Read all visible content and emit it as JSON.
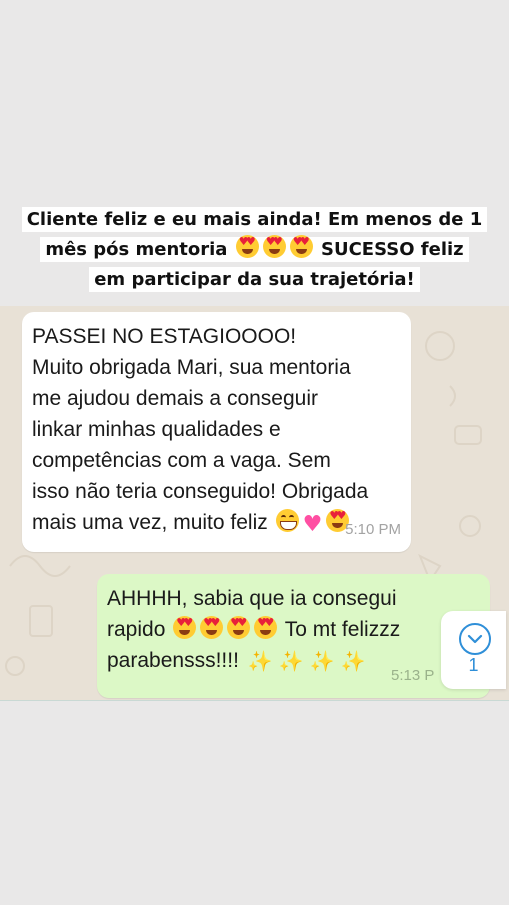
{
  "story_caption": {
    "line1": "Cliente feliz e eu mais ainda! Em menos de 1",
    "line2_before": "mês pós mentoria",
    "line2_after": "SUCESSO feliz",
    "line3": "em participar da sua trajetória!",
    "emojis": [
      "smiling-face-with-heart-eyes",
      "smiling-face-with-heart-eyes",
      "smiling-face-with-heart-eyes"
    ]
  },
  "chat": {
    "background_color": "#e8e1d6",
    "incoming": {
      "lines": [
        "PASSEI NO ESTAGIOOOO!",
        "Muito obrigada Mari, sua mentoria",
        "me ajudou demais a conseguir",
        "linkar minhas qualidades e",
        "competências com a vaga. Sem",
        "isso não teria conseguido! Obrigada",
        "mais uma vez, muito feliz"
      ],
      "trailing_emojis": [
        "beaming-face-with-smiling-eyes",
        "heart-with-ribbon",
        "smiling-face-with-heart-eyes"
      ],
      "time": "5:10 PM",
      "bubble_color": "#ffffff"
    },
    "outgoing": {
      "line1": "AHHHH, sabia que ia consegui",
      "line2_before": "rapido",
      "line2_after": "To mt felizzz",
      "line3": "parabensss!!!!",
      "emojis_line2": [
        "smiling-face-with-heart-eyes",
        "smiling-face-with-heart-eyes",
        "smiling-face-with-heart-eyes",
        "smiling-face-with-heart-eyes"
      ],
      "emojis_line3": [
        "sparkles",
        "sparkles",
        "sparkles",
        "sparkles"
      ],
      "time": "5:13 P",
      "bubble_color": "#dcf8c6"
    },
    "scroll_button": {
      "icon": "chevron-down-icon",
      "unread_count": "1"
    }
  }
}
